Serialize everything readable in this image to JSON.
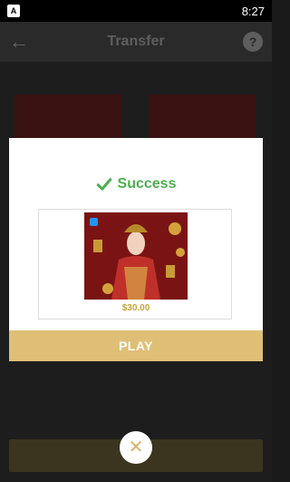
{
  "status_bar": {
    "time": "8:27",
    "app_icon": "A"
  },
  "app_bar": {
    "title": "Transfer",
    "help_label": "?"
  },
  "modal": {
    "success_text": "Success",
    "game_amount": "$30.00",
    "play_label": "PLAY"
  },
  "colors": {
    "accent_gold": "#dfbf75",
    "success_green": "#4caf50",
    "amount_gold": "#c9a33f"
  },
  "icons": {
    "back": "arrow-left-icon",
    "help": "question-circle-icon",
    "success": "check-icon",
    "close": "close-icon"
  }
}
